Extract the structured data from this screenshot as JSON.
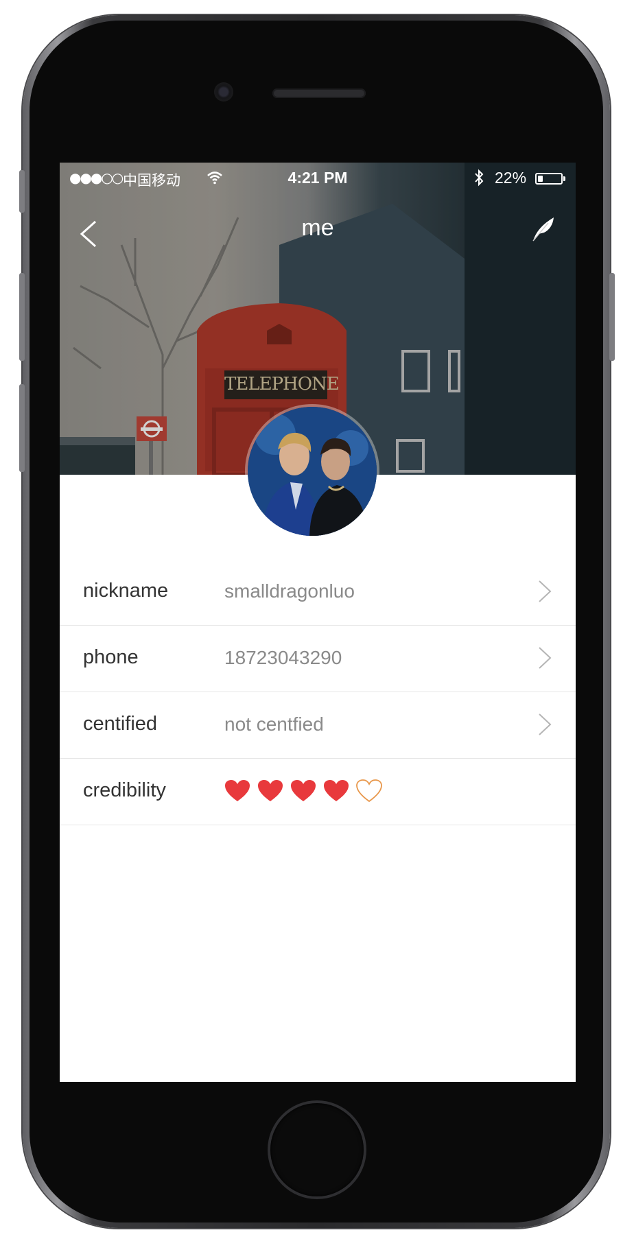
{
  "status_bar": {
    "signal": "●●●○○",
    "carrier": "中国移动",
    "time": "4:21 PM",
    "battery_percent": "22%",
    "battery_level": 0.22
  },
  "nav": {
    "title": "me"
  },
  "hero": {
    "sign_text": "TELEPHONE"
  },
  "profile": {
    "rows": [
      {
        "label": "nickname",
        "value": "smalldragonluo"
      },
      {
        "label": "phone",
        "value": "18723043290"
      },
      {
        "label": "centified",
        "value": "not centfied"
      },
      {
        "label": "credibility"
      }
    ],
    "credibility_rating": 4,
    "credibility_max": 5
  },
  "colors": {
    "heart_filled": "#e8393c",
    "heart_empty": "#e8974a",
    "label_text": "#333333",
    "value_text": "#8a8a8a",
    "divider": "#e6e6e6"
  },
  "icons": {
    "back": "chevron-left-icon",
    "edit": "feather-icon",
    "row_arrow": "chevron-right-icon",
    "wifi": "wifi-icon",
    "bluetooth": "bluetooth-icon",
    "battery": "battery-icon",
    "heart": "heart-icon"
  }
}
